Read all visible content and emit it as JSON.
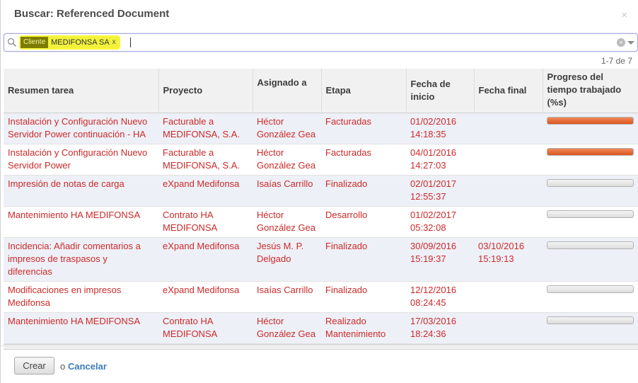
{
  "dialog": {
    "title": "Buscar: Referenced Document",
    "close_glyph": "×"
  },
  "search": {
    "facet_category": "Cliente",
    "facet_value": "MEDIFONSA SA",
    "facet_remove": "x",
    "query": "",
    "clear_glyph": "×"
  },
  "pager": "1-7 de 7",
  "columns": [
    "Resumen tarea",
    "Proyecto",
    "Asignado a",
    "Etapa",
    "Fecha de inicio",
    "Fecha final",
    "Progreso del tiempo trabajado (%s)"
  ],
  "rows": [
    {
      "summary": "Instalación y Configuración Nuevo Servidor Power continuación - HA",
      "project": "Facturable a MEDIFONSA, S.A.",
      "assigned": "Héctor González Gea",
      "stage": "Facturadas",
      "start": "01/02/2016 14:18:35",
      "end": "",
      "progress": 100
    },
    {
      "summary": "Instalación y Configuración Nuevo Servidor Power",
      "project": "Facturable a MEDIFONSA, S.A.",
      "assigned": "Héctor González Gea",
      "stage": "Facturadas",
      "start": "04/01/2016 14:27:03",
      "end": "",
      "progress": 100
    },
    {
      "summary": "Impresión de notas de carga",
      "project": "eXpand Medifonsa",
      "assigned": "Isaías Carrillo",
      "stage": "Finalizado",
      "start": "02/01/2017 12:55:37",
      "end": "",
      "progress": 0
    },
    {
      "summary": "Mantenimiento HA MEDIFONSA",
      "project": "Contrato HA MEDIFONSA",
      "assigned": "Héctor González Gea",
      "stage": "Desarrollo",
      "start": "01/02/2017 05:32:08",
      "end": "",
      "progress": 0
    },
    {
      "summary": "Incidencia: Añadir comentarios a impresos de traspasos y diferencias",
      "project": "eXpand Medifonsa",
      "assigned": "Jesús M. P. Delgado",
      "stage": "Finalizado",
      "start": "30/09/2016 15:19:37",
      "end": "03/10/2016 15:19:13",
      "progress": 0
    },
    {
      "summary": "Modificaciones en impresos Medifonsa",
      "project": "eXpand Medifonsa",
      "assigned": "Isaías Carrillo",
      "stage": "Finalizado",
      "start": "12/12/2016 08:24:45",
      "end": "",
      "progress": 0
    },
    {
      "summary": "Mantenimiento HA MEDIFONSA",
      "project": "Contrato HA MEDIFONSA",
      "assigned": "Héctor González Gea",
      "stage": "Realizado Mantenimiento",
      "start": "17/03/2016 18:24:36",
      "end": "",
      "progress": 0
    }
  ],
  "footer": {
    "create_label": "Crear",
    "or_label": "o",
    "cancel_label": "Cancelar"
  },
  "colors": {
    "row_text": "#cc2a2a",
    "progress_fill": "#e0622b",
    "facet_highlight": "#f2f23c",
    "link": "#3b7bbf"
  }
}
